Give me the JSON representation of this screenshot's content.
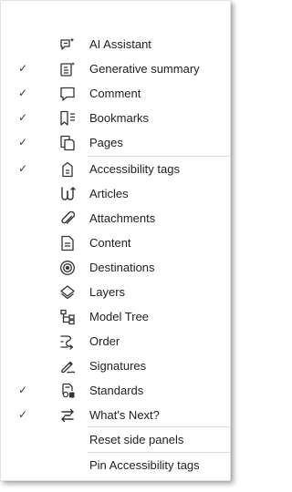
{
  "menu": {
    "items": [
      {
        "label": "AI Assistant",
        "checked": "",
        "icon": "ai-assistant-icon"
      },
      {
        "label": "Generative summary",
        "checked": "✓",
        "icon": "generative-summary-icon"
      },
      {
        "label": "Comment",
        "checked": "✓",
        "icon": "comment-icon"
      },
      {
        "label": "Bookmarks",
        "checked": "✓",
        "icon": "bookmarks-icon"
      },
      {
        "label": "Pages",
        "checked": "✓",
        "icon": "pages-icon"
      },
      {
        "label": "Accessibility tags",
        "checked": "✓",
        "icon": "accessibility-tags-icon"
      },
      {
        "label": "Articles",
        "checked": "",
        "icon": "articles-icon"
      },
      {
        "label": "Attachments",
        "checked": "",
        "icon": "attachments-icon"
      },
      {
        "label": "Content",
        "checked": "",
        "icon": "content-icon"
      },
      {
        "label": "Destinations",
        "checked": "",
        "icon": "destinations-icon"
      },
      {
        "label": "Layers",
        "checked": "",
        "icon": "layers-icon"
      },
      {
        "label": "Model Tree",
        "checked": "",
        "icon": "model-tree-icon"
      },
      {
        "label": "Order",
        "checked": "",
        "icon": "order-icon"
      },
      {
        "label": "Signatures",
        "checked": "",
        "icon": "signatures-icon"
      },
      {
        "label": "Standards",
        "checked": "✓",
        "icon": "standards-icon"
      },
      {
        "label": "What's Next?",
        "checked": "✓",
        "icon": "whats-next-icon"
      }
    ],
    "reset_label": "Reset side panels",
    "pin_label": "Pin Accessibility tags"
  }
}
